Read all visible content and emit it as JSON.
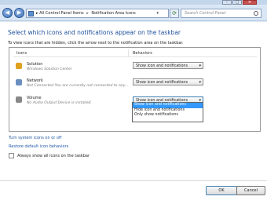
{
  "address": {
    "crumbs": [
      "All Control Panel Items",
      "Notification Area Icons"
    ],
    "separator": "▸"
  },
  "search": {
    "placeholder": "Search Control Panel"
  },
  "main": {
    "heading": "Select which icons and notifications appear on the taskbar",
    "instructions": "To view icons that are hidden, click the arrow next to the notification area on the taskbar.",
    "columns": {
      "icons": "Icons",
      "behaviors": "Behaviors"
    },
    "rows": [
      {
        "name": "Solution",
        "desc": "Windows Solution Center",
        "behavior": "Show icon and notifications"
      },
      {
        "name": "Network",
        "desc": "Not Connected You are currently not connected to any...",
        "behavior": "Show icon and notifications"
      },
      {
        "name": "Volume",
        "desc": "No Audio Output Device is installed.",
        "behavior": "Show icon and notifications"
      }
    ],
    "dropdown_options": [
      "Show icon and notifications",
      "Hide icon and notifications",
      "Only show notifications"
    ],
    "links": {
      "turn_system_icons": "Turn system icons on or off",
      "restore_defaults": "Restore default icon behaviors"
    },
    "always_show_label": "Always show all icons on the taskbar",
    "always_show_checked": false
  },
  "footer": {
    "ok_label": "OK",
    "cancel_label": "Cancel"
  },
  "colors": {
    "heading": "#1d4e9a",
    "link": "#1f57a5",
    "selection": "#3399ff"
  },
  "icons": {
    "solution": "flag-icon",
    "network": "network-icon",
    "volume": "speaker-icon"
  }
}
